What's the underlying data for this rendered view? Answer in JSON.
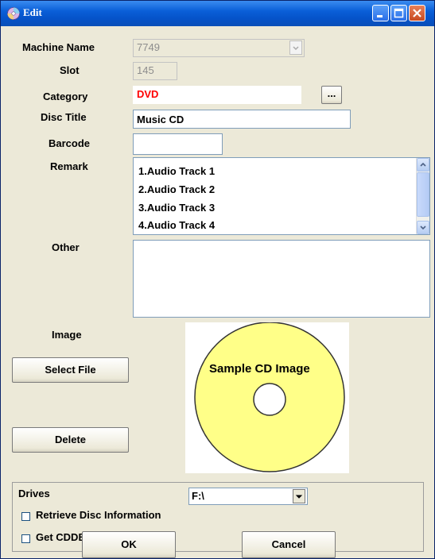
{
  "window": {
    "title": "Edit"
  },
  "labels": {
    "machine_name": "Machine Name",
    "slot": "Slot",
    "category": "Category",
    "disc_title": "Disc Title",
    "barcode": "Barcode",
    "remark": "Remark",
    "other": "Other",
    "image": "Image",
    "drives": "Drives"
  },
  "fields": {
    "machine_name": "7749",
    "slot": "145",
    "category": "DVD",
    "category_color": "#ff0000",
    "disc_title": "Music CD",
    "barcode": "",
    "other": "",
    "drive": "F:\\"
  },
  "remark_items": [
    "1.Audio Track 1",
    "2.Audio Track 2",
    "3.Audio Track 3",
    "4.Audio Track 4"
  ],
  "buttons": {
    "browse": "...",
    "select_file": "Select File",
    "delete": "Delete",
    "ok": "OK",
    "cancel": "Cancel"
  },
  "image": {
    "caption": "Sample CD Image",
    "disc_color": "#ffff88"
  },
  "options": {
    "retrieve_disc_info": {
      "label": "Retrieve Disc Information",
      "checked": false
    },
    "get_cddb": {
      "label": "Get CDDB",
      "checked": false
    }
  },
  "icons": [
    "cd-icon",
    "minimize-icon",
    "maximize-icon",
    "close-icon",
    "dropdown-arrow-icon",
    "scroll-up-icon",
    "scroll-down-icon"
  ]
}
